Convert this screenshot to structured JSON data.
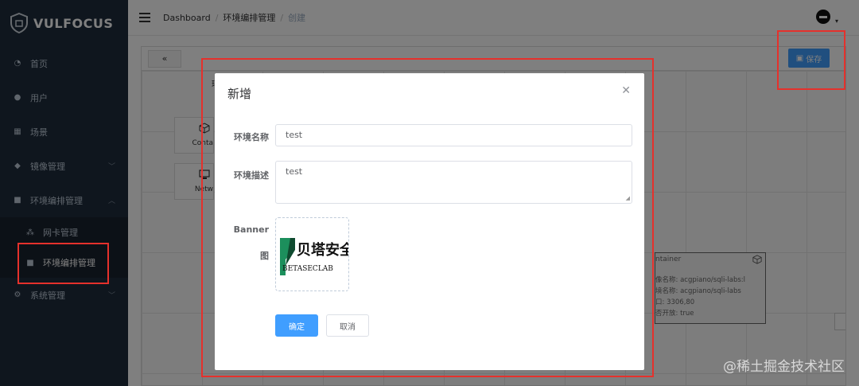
{
  "brand": {
    "name": "VULFOCUS"
  },
  "sidebar": {
    "items": [
      {
        "label": "首页",
        "icon": "dashboard-icon"
      },
      {
        "label": "用户",
        "icon": "user-icon"
      },
      {
        "label": "场景",
        "icon": "table-icon"
      },
      {
        "label": "镜像管理",
        "icon": "ship-icon"
      },
      {
        "label": "环境编排管理",
        "icon": "layout-icon"
      },
      {
        "label": "系统管理",
        "icon": "gear-icon"
      }
    ],
    "subitems": [
      {
        "label": "网卡管理",
        "icon": "network-icon"
      },
      {
        "label": "环境编排管理",
        "icon": "layout-icon"
      }
    ]
  },
  "header": {
    "breadcrumb": [
      "Dashboard",
      "环境编排管理",
      "创建"
    ],
    "separator": "/"
  },
  "canvas": {
    "panel_title": "环境",
    "tools": [
      "Conta",
      "Netw"
    ],
    "save_label": "保存",
    "container_node": {
      "title": "ntainer",
      "lines": [
        "像名称: acgpiano/sqli-labs:l",
        "境名称: acgpiano/sqli-labs",
        "口: 3306,80",
        "否开放: true"
      ]
    }
  },
  "modal": {
    "title": "新增",
    "name_label": "环境名称",
    "name_value": "test",
    "desc_label": "环境描述",
    "desc_value": "test",
    "banner_label_1": "Banner",
    "banner_label_2": "图",
    "banner_logo_cn": "贝塔安全",
    "banner_logo_en": "BETASECLAB",
    "confirm_label": "确定",
    "cancel_label": "取消"
  },
  "watermark": "@稀土掘金技术社区",
  "colors": {
    "sidebar_bg": "#1f2d3d",
    "primary": "#409eff",
    "highlight": "#e5312c"
  }
}
